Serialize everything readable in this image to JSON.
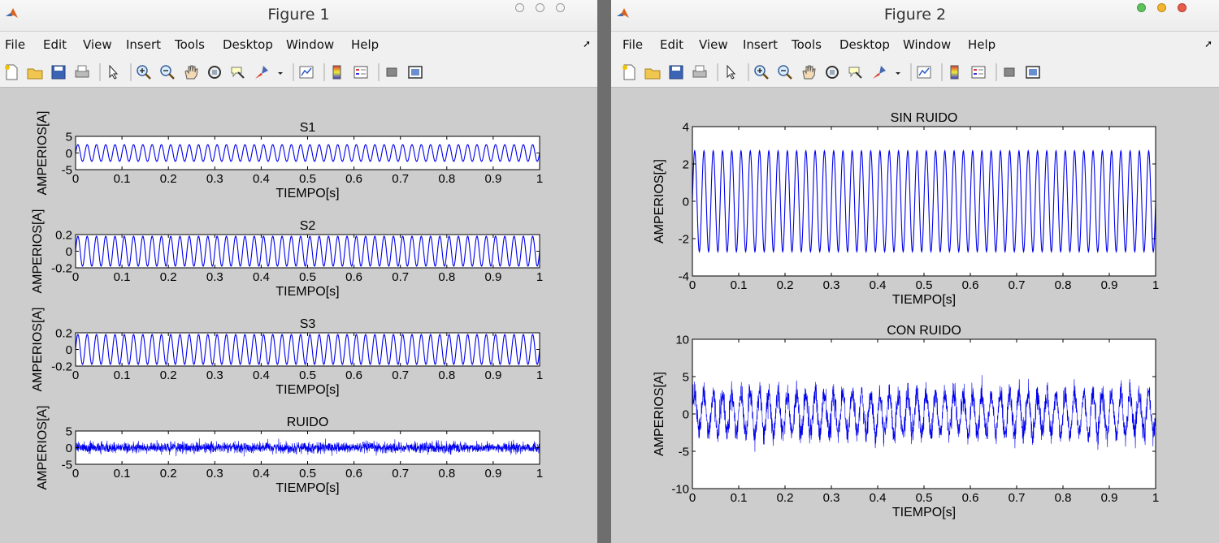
{
  "windows": [
    {
      "title": "Figure 1",
      "menu": [
        "File",
        "Edit",
        "View",
        "Insert",
        "Tools",
        "Desktop",
        "Window",
        "Help"
      ],
      "subplots": [
        {
          "title": "S1",
          "xlabel": "TIEMPO[s]",
          "ylabel": "AMPERIOS[A]",
          "yticks": [
            "5",
            "0",
            "-5"
          ],
          "xticks": [
            "0",
            "0.1",
            "0.2",
            "0.3",
            "0.4",
            "0.5",
            "0.6",
            "0.7",
            "0.8",
            "0.9",
            "1"
          ]
        },
        {
          "title": "S2",
          "xlabel": "TIEMPO[s]",
          "ylabel": "AMPERIOS[A]",
          "yticks": [
            "0.2",
            "0",
            "-0.2"
          ],
          "xticks": [
            "0",
            "0.1",
            "0.2",
            "0.3",
            "0.4",
            "0.5",
            "0.6",
            "0.7",
            "0.8",
            "0.9",
            "1"
          ]
        },
        {
          "title": "S3",
          "xlabel": "TIEMPO[s]",
          "ylabel": "AMPERIOS[A]",
          "yticks": [
            "0.2",
            "0",
            "-0.2"
          ],
          "xticks": [
            "0",
            "0.1",
            "0.2",
            "0.3",
            "0.4",
            "0.5",
            "0.6",
            "0.7",
            "0.8",
            "0.9",
            "1"
          ]
        },
        {
          "title": "RUIDO",
          "xlabel": "TIEMPO[s]",
          "ylabel": "AMPERIOS[A]",
          "yticks": [
            "5",
            "0",
            "-5"
          ],
          "xticks": [
            "0",
            "0.1",
            "0.2",
            "0.3",
            "0.4",
            "0.5",
            "0.6",
            "0.7",
            "0.8",
            "0.9",
            "1"
          ]
        }
      ]
    },
    {
      "title": "Figure 2",
      "menu": [
        "File",
        "Edit",
        "View",
        "Insert",
        "Tools",
        "Desktop",
        "Window",
        "Help"
      ],
      "subplots": [
        {
          "title": "SIN RUIDO",
          "xlabel": "TIEMPO[s]",
          "ylabel": "AMPERIOS[A]",
          "yticks": [
            "4",
            "2",
            "0",
            "-2",
            "-4"
          ],
          "xticks": [
            "0",
            "0.1",
            "0.2",
            "0.3",
            "0.4",
            "0.5",
            "0.6",
            "0.7",
            "0.8",
            "0.9",
            "1"
          ]
        },
        {
          "title": "CON RUIDO",
          "xlabel": "TIEMPO[s]",
          "ylabel": "AMPERIOS[A]",
          "yticks": [
            "10",
            "5",
            "0",
            "-5",
            "-10"
          ],
          "xticks": [
            "0",
            "0.1",
            "0.2",
            "0.3",
            "0.4",
            "0.5",
            "0.6",
            "0.7",
            "0.8",
            "0.9",
            "1"
          ]
        }
      ]
    }
  ],
  "colors": {
    "trace": "#0000ee",
    "axes_bg": "#ffffff",
    "figure_bg": "#cdcdcd"
  },
  "chart_data": [
    {
      "type": "line",
      "title": "S1",
      "xlabel": "TIEMPO[s]",
      "ylabel": "AMPERIOS[A]",
      "xlim": [
        0,
        1
      ],
      "ylim": [
        -5,
        5
      ],
      "series": [
        {
          "kind": "sine",
          "amplitude": 2.5,
          "frequency_hz": 50
        }
      ]
    },
    {
      "type": "line",
      "title": "S2",
      "xlabel": "TIEMPO[s]",
      "ylabel": "AMPERIOS[A]",
      "xlim": [
        0,
        1
      ],
      "ylim": [
        -0.2,
        0.2
      ],
      "series": [
        {
          "kind": "sine",
          "amplitude": 0.18,
          "frequency_hz": 50
        }
      ]
    },
    {
      "type": "line",
      "title": "S3",
      "xlabel": "TIEMPO[s]",
      "ylabel": "AMPERIOS[A]",
      "xlim": [
        0,
        1
      ],
      "ylim": [
        -0.2,
        0.2
      ],
      "series": [
        {
          "kind": "sine",
          "amplitude": 0.18,
          "frequency_hz": 50
        }
      ]
    },
    {
      "type": "line",
      "title": "RUIDO",
      "xlabel": "TIEMPO[s]",
      "ylabel": "AMPERIOS[A]",
      "xlim": [
        0,
        1
      ],
      "ylim": [
        -5,
        5
      ],
      "series": [
        {
          "kind": "noise",
          "std": 0.8
        }
      ]
    },
    {
      "type": "line",
      "title": "SIN RUIDO",
      "xlabel": "TIEMPO[s]",
      "ylabel": "AMPERIOS[A]",
      "xlim": [
        0,
        1
      ],
      "ylim": [
        -4,
        4
      ],
      "series": [
        {
          "kind": "sine",
          "amplitude": 2.7,
          "frequency_hz": 50
        }
      ]
    },
    {
      "type": "line",
      "title": "CON RUIDO",
      "xlabel": "TIEMPO[s]",
      "ylabel": "AMPERIOS[A]",
      "xlim": [
        0,
        1
      ],
      "ylim": [
        -10,
        10
      ],
      "series": [
        {
          "kind": "sine_plus_noise",
          "amplitude": 2.7,
          "frequency_hz": 50,
          "noise_std": 0.8
        }
      ]
    }
  ]
}
